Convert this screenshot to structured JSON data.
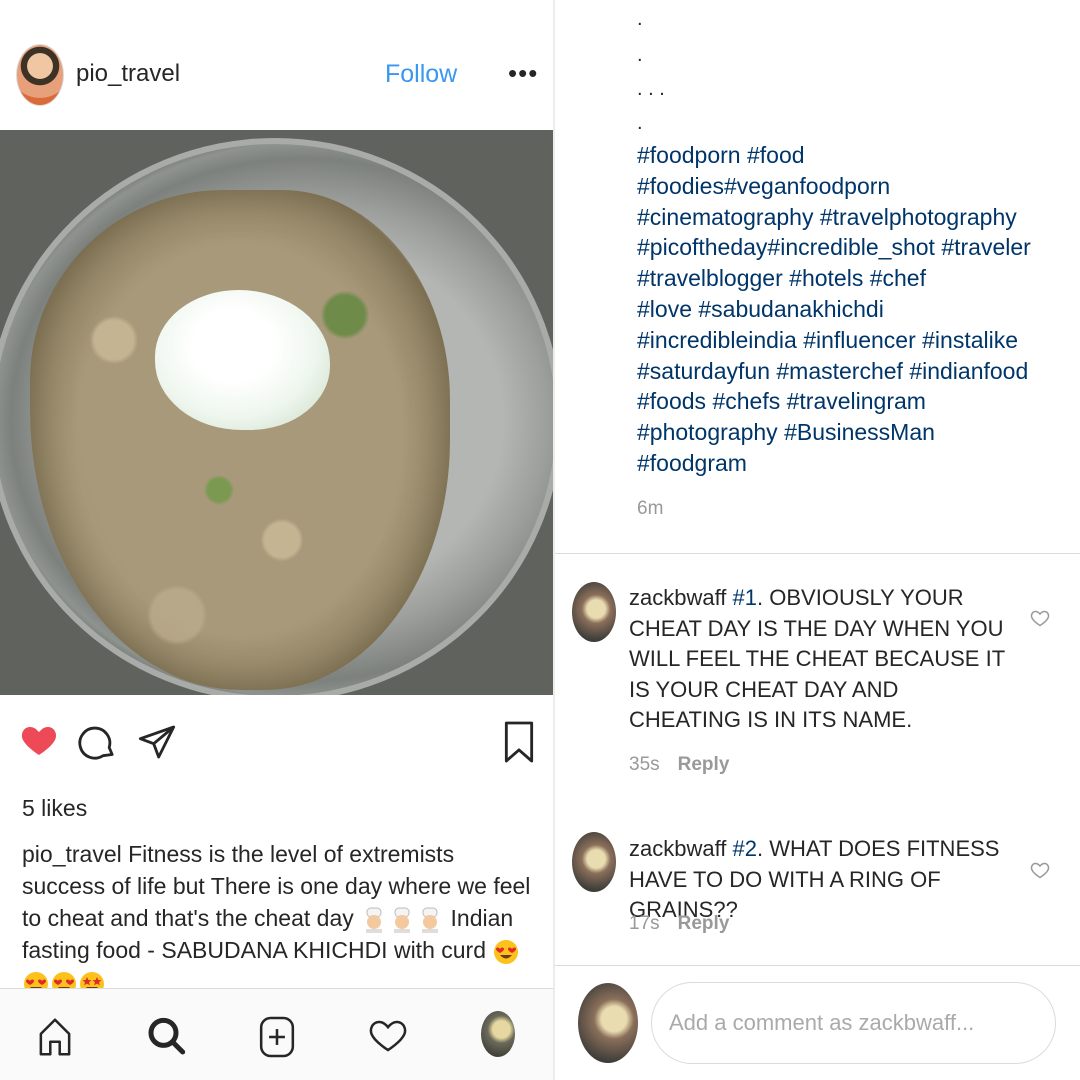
{
  "post": {
    "username": "pio_travel",
    "follow_label": "Follow",
    "more_label": "•••",
    "likes": "5 likes",
    "caption_user": "pio_travel",
    "caption_text_1": " Fitness is the level of extremists success of life but There is one day where we feel to cheat and that's the cheat day ",
    "caption_text_2": " Indian fasting food - SABUDANA KHICHDI with curd ",
    "dots": [
      ".",
      ".",
      ". . .",
      "."
    ],
    "hashtag_lines": [
      "#foodporn #food",
      "#foodies#veganfoodporn",
      "#cinematography #travelphotography",
      "#picoftheday#incredible_shot #traveler",
      "#travelblogger #hotels #chef",
      "#love #sabudanakhichdi",
      "#incredibleindia #influencer #instalike",
      "#saturdayfun #masterchef #indianfood",
      "#foods #chefs #travelingram",
      "#photography #BusinessMan",
      "#foodgram"
    ],
    "time": "6m"
  },
  "comments": [
    {
      "user": "zackbwaff",
      "number": "#1",
      "text": ". OBVIOUSLY YOUR CHEAT DAY IS THE DAY WHEN YOU WILL FEEL THE CHEAT BECAUSE IT IS YOUR CHEAT DAY AND CHEATING IS IN ITS NAME.",
      "time": "35s",
      "reply_label": "Reply"
    },
    {
      "user": "zackbwaff",
      "number": "#2",
      "text": ". WHAT DOES FITNESS HAVE TO DO WITH A RING OF GRAINS??",
      "time": "17s",
      "reply_label": "Reply"
    }
  ],
  "composer": {
    "placeholder": "Add a comment as zackbwaff..."
  },
  "icons": {
    "like": "heart-icon-filled",
    "comment": "comment-icon",
    "share": "paper-plane-icon",
    "save": "bookmark-icon",
    "home": "home-icon",
    "search": "search-icon",
    "add": "add-post-icon",
    "activity": "heart-outline-icon",
    "profile": "profile-avatar"
  },
  "colors": {
    "like_red": "#ed4956",
    "follow_blue": "#3897f0",
    "hashtag_blue": "#003569",
    "meta_gray": "#999999"
  }
}
